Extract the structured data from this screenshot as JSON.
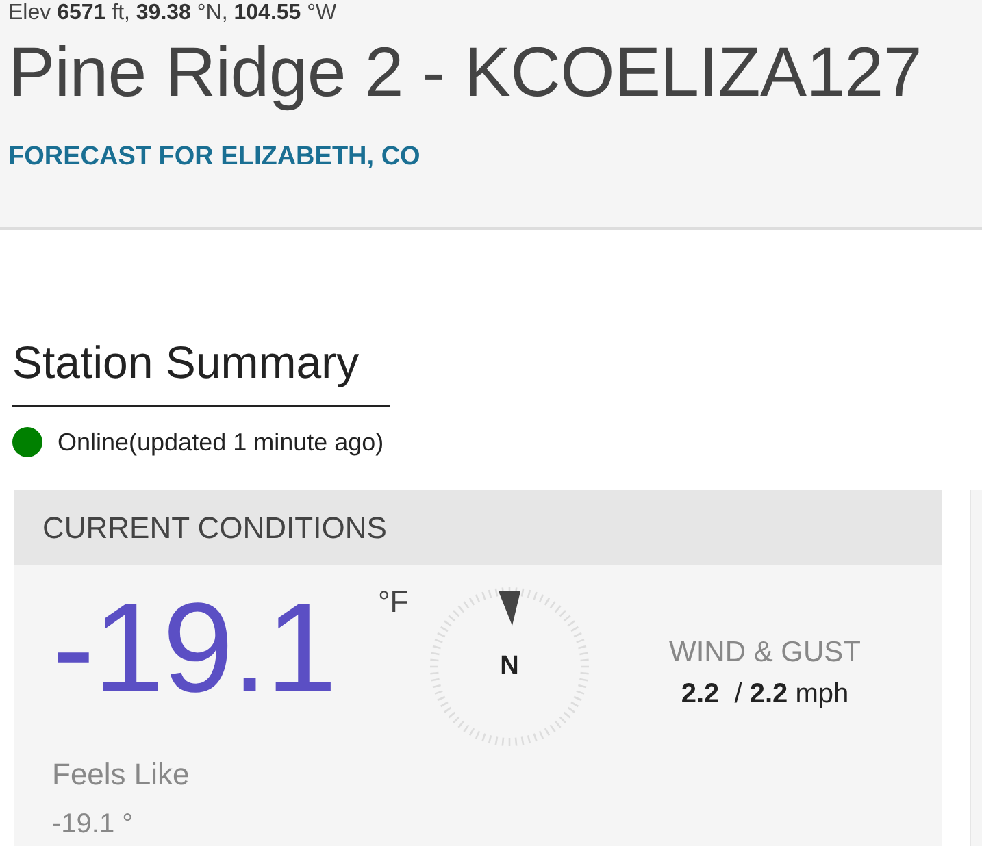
{
  "header": {
    "location_line": "Elev **6571** ft, **39.38** °N, **104.55** °W",
    "title": "Pine Ridge 2 - KCOELIZA127",
    "forecast_link": "FORECAST FOR ELIZABETH, CO"
  },
  "summary": {
    "heading": "Station Summary",
    "status": {
      "text": "Online(updated 1 minute ago)",
      "color": "#008000"
    }
  },
  "current_conditions": {
    "heading": "CURRENT CONDITIONS",
    "temperature": "-19.1",
    "unit": "°F",
    "feels_like_label": "Feels Like",
    "feels_like": "-19.1 °",
    "wind_direction": "N",
    "wind_label": "WIND & GUST",
    "wind_value": "**2.2**  / **2.2** mph"
  }
}
